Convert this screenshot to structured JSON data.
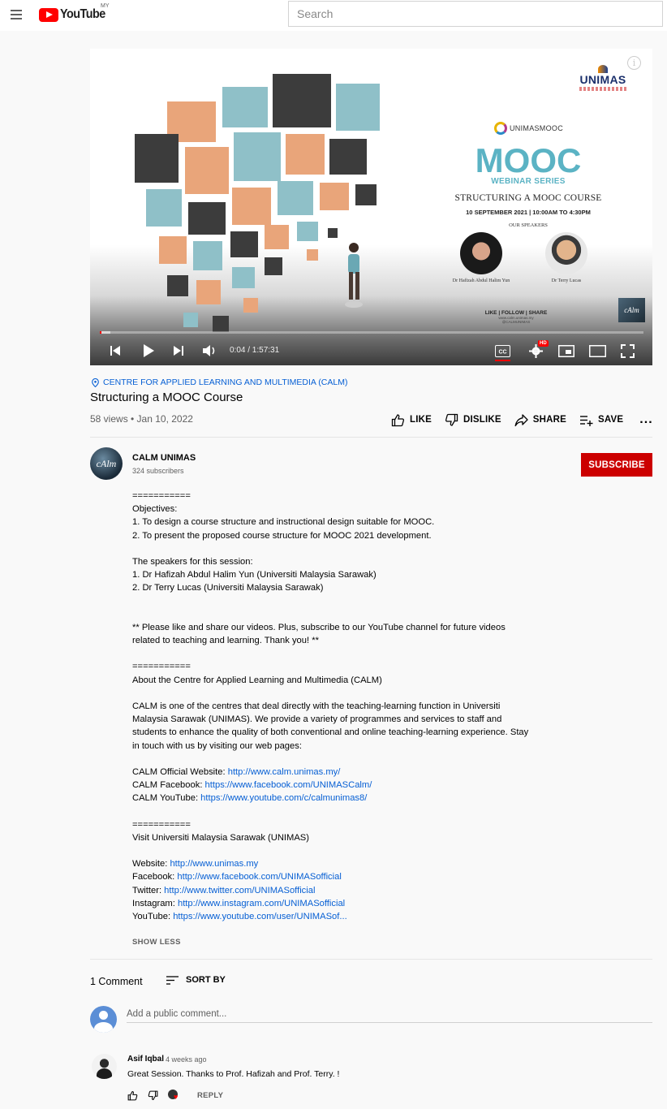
{
  "masthead": {
    "logo_text": "YouTube",
    "country": "MY",
    "search_placeholder": "Search"
  },
  "thumbnail": {
    "unimas_logo": "UNIMAS",
    "brand": "UNIMASMOOC",
    "heading": "MOOC",
    "subheading": "WEBINAR SERIES",
    "course": "STRUCTURING A MOOC COURSE",
    "date": "10 SEPTEMBER 2021 | 10:00AM TO 4:30PM",
    "speakers_label": "OUR SPEAKERS",
    "speaker1": "Dr Hafizah Abdul Halim Yun",
    "speaker2": "Dr Terry Lucas",
    "social": "LIKE | FOLLOW | SHARE",
    "social_small": "www.calm.unimas.my",
    "social_handle": "@CALMUNIMAS",
    "corner_logo": "cAlm"
  },
  "player": {
    "time": "0:04 / 1:57:31",
    "progress_played": 0.002,
    "progress_loaded": 0.02,
    "hd_badge": "HD",
    "cc_label": "CC"
  },
  "video": {
    "location": "CENTRE FOR APPLIED LEARNING AND MULTIMEDIA (CALM)",
    "title": "Structuring a MOOC Course",
    "meta": "58 views • Jan 10, 2022",
    "like_label": "LIKE",
    "dislike_label": "DISLIKE",
    "share_label": "SHARE",
    "save_label": "SAVE",
    "more_label": "..."
  },
  "channel": {
    "avatar_text": "cAlm",
    "name": "CALM UNIMAS",
    "subscribers": "324 subscribers",
    "subscribe_label": "SUBSCRIBE"
  },
  "description": {
    "sep1": "===========",
    "obj_head": "Objectives:",
    "obj1": "1. To design a course structure and instructional design suitable for MOOC.",
    "obj2": "2. To present the proposed course structure for MOOC 2021 development.",
    "spk_head": "The speakers for this session:",
    "spk1": "1. Dr Hafizah Abdul Halim Yun (Universiti Malaysia Sarawak)",
    "spk2": "2. Dr Terry Lucas (Universiti Malaysia Sarawak)",
    "cta1": "** Please like and share our videos. Plus, subscribe to our YouTube channel for future videos",
    "cta2": "related to teaching and learning. Thank you! **",
    "sep2": "===========",
    "about_head": "About the Centre for Applied Learning and Multimedia (CALM)",
    "about1": "CALM is one of the centres that deal directly with the teaching-learning function in Universiti",
    "about2": "Malaysia Sarawak (UNIMAS). We provide a variety of programmes and services to staff and",
    "about3": "students to enhance the quality of both conventional and online teaching-learning experience. Stay",
    "about4": "in touch with us by visiting our web pages:",
    "calm_web_label": "CALM Official Website: ",
    "calm_web_url": "http://www.calm.unimas.my/",
    "calm_fb_label": "CALM Facebook: ",
    "calm_fb_url": "https://www.facebook.com/UNIMASCalm/",
    "calm_yt_label": "CALM YouTube: ",
    "calm_yt_url": "https://www.youtube.com/c/calmunimas8/",
    "sep3": "===========",
    "visit_head": "Visit Universiti Malaysia Sarawak (UNIMAS)",
    "uni_web_label": "Website: ",
    "uni_web_url": "http://www.unimas.my",
    "uni_fb_label": "Facebook: ",
    "uni_fb_url": "http://www.facebook.com/UNIMASofficial",
    "uni_tw_label": "Twitter: ",
    "uni_tw_url": "http://www.twitter.com/UNIMASofficial",
    "uni_ig_label": "Instagram: ",
    "uni_ig_url": "http://www.instagram.com/UNIMASofficial",
    "uni_yt_label": "YouTube: ",
    "uni_yt_url": "https://www.youtube.com/user/UNIMASof...",
    "show_less": "SHOW LESS"
  },
  "comments": {
    "count": "1 Comment",
    "sort_label": "SORT BY",
    "add_placeholder": "Add a public comment...",
    "items": [
      {
        "author": "Asif Iqbal",
        "time": "4 weeks ago",
        "text": "Great Session. Thanks to Prof. Hafizah and Prof. Terry. !",
        "reply_label": "REPLY"
      }
    ]
  },
  "colors": {
    "brand_red": "#ff0000",
    "subscribe_red": "#cc0000",
    "link_blue": "#065fd4",
    "mooc_teal": "#5bb3c4"
  }
}
